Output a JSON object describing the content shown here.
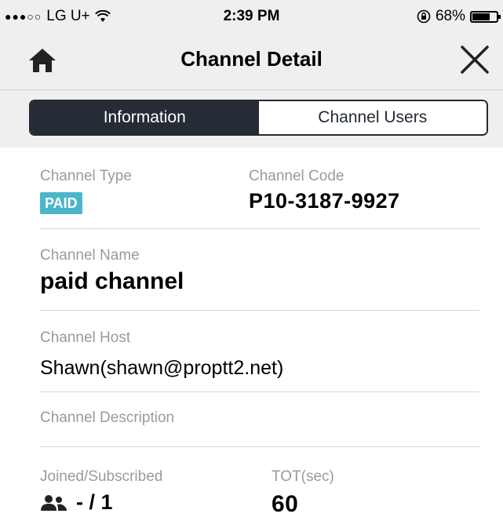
{
  "status": {
    "carrier": "LG U+",
    "time": "2:39 PM",
    "battery": "68%",
    "battery_level": 0.68
  },
  "nav": {
    "title": "Channel Detail",
    "home_icon": "home-icon",
    "close_icon": "close-icon"
  },
  "tabs": [
    {
      "label": "Information",
      "active": true
    },
    {
      "label": "Channel Users",
      "active": false
    }
  ],
  "details": {
    "channel_type_label": "Channel Type",
    "channel_type_value": "PAID",
    "channel_code_label": "Channel Code",
    "channel_code_value": "P10-3187-9927",
    "channel_name_label": "Channel Name",
    "channel_name_value": "paid channel",
    "channel_host_label": "Channel Host",
    "channel_host_value": "Shawn(shawn@proptt2.net)",
    "channel_desc_label": "Channel Description",
    "channel_desc_value": "",
    "joined_label": "Joined/Subscribed",
    "joined_value": "- / 1",
    "tot_label": "TOT(sec)",
    "tot_value": "60"
  },
  "colors": {
    "badge": "#4cb6c9",
    "segment_active": "#252c35"
  }
}
